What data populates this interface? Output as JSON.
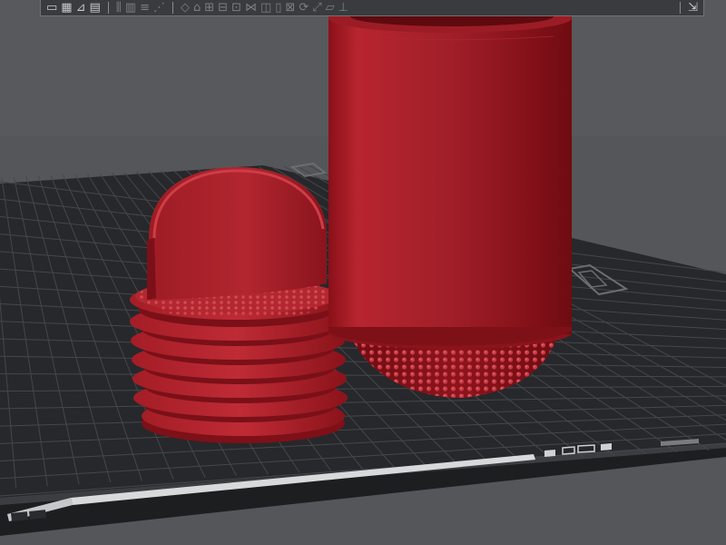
{
  "viewport": {
    "background_color": "#55565a",
    "bed": {
      "color": "#27282b",
      "grid_color": "#46484c",
      "label_strip_text": "",
      "label_strip_sub": ""
    },
    "model": {
      "name": "pill capsule container",
      "color": "#a71e26",
      "parts": [
        "threaded-cap",
        "capsule-body"
      ]
    }
  },
  "toolbar": {
    "background_color": "#3a3b3e",
    "icons": [
      {
        "name": "add-object-icon",
        "glyph": "▭"
      },
      {
        "name": "arrange-icon",
        "glyph": "▦"
      },
      {
        "name": "orientation-icon",
        "glyph": "⊿"
      },
      {
        "name": "slice-view-icon",
        "glyph": "▤"
      },
      {
        "name": "cut-icon",
        "glyph": "⫼"
      },
      {
        "name": "split-objects-icon",
        "glyph": "▥"
      },
      {
        "name": "layers-icon",
        "glyph": "≡"
      },
      {
        "name": "paint-support-icon",
        "glyph": "⋰"
      },
      {
        "name": "seam-paint-icon",
        "glyph": "◇"
      },
      {
        "name": "text-emboss-icon",
        "glyph": "⌂"
      },
      {
        "name": "measure-icon",
        "glyph": "⊞"
      },
      {
        "name": "assembly-icon",
        "glyph": "⊟"
      },
      {
        "name": "variable-layer-icon",
        "glyph": "⊡"
      },
      {
        "name": "brim-ears-icon",
        "glyph": "⋈"
      },
      {
        "name": "mesh-boolean-icon",
        "glyph": "◫"
      },
      {
        "name": "fuzzy-skin-icon",
        "glyph": "▯"
      },
      {
        "name": "scale-icon",
        "glyph": "⊠"
      },
      {
        "name": "rotate-icon",
        "glyph": "⟳"
      },
      {
        "name": "move-icon",
        "glyph": "⤢"
      },
      {
        "name": "flatten-icon",
        "glyph": "▱"
      },
      {
        "name": "drop-icon",
        "glyph": "⊥"
      },
      {
        "name": "collapse-toolbar-icon",
        "glyph": "⇲"
      }
    ]
  }
}
